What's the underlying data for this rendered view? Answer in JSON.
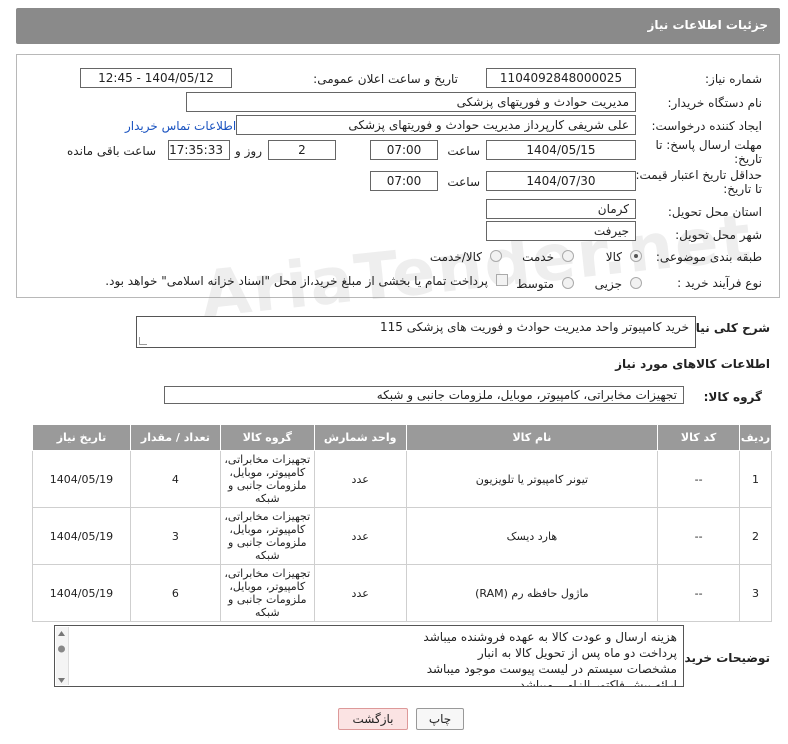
{
  "header": {
    "title": "جزئیات اطلاعات نیاز"
  },
  "form": {
    "need_number_label": "شماره نیاز:",
    "need_number": "1104092848000025",
    "announce_label": "تاریخ و ساعت اعلان عمومی:",
    "announce_value": "1404/05/12 - 12:45",
    "buyer_org_label": "نام دستگاه خریدار:",
    "buyer_org": "مدیریت حوادث و فوریتهای پزشکی",
    "creator_label": "ایجاد کننده درخواست:",
    "creator": "علی شریفی کارپرداز مدیریت حوادث و فوریتهای پزشکی",
    "contact_link": "اطلاعات تماس خریدار",
    "deadline_label_1": "مهلت ارسال پاسخ: تا",
    "deadline_label_2": "تاریخ:",
    "deadline_date": "1404/05/15",
    "time_label": "ساعت",
    "deadline_time": "07:00",
    "days_value": "2",
    "days_label": "روز و",
    "remaining_time": "17:35:33",
    "remaining_label": "ساعت باقی مانده",
    "price_validity_label_1": "حداقل تاریخ اعتبار قیمت:",
    "price_validity_label_2": "تا تاریخ:",
    "price_validity_date": "1404/07/30",
    "price_validity_time": "07:00",
    "province_label": "استان محل تحویل:",
    "province": "کرمان",
    "city_label": "شهر محل تحویل:",
    "city": "جیرفت",
    "category_label": "طبقه بندی موضوعی:",
    "category_options": [
      "کالا",
      "خدمت",
      "کالا/خدمت"
    ],
    "process_label": "نوع فرآیند خرید :",
    "process_options": [
      "جزیی",
      "متوسط"
    ],
    "process_note": "پرداخت تمام یا بخشی از مبلغ خرید،از محل \"اسناد خزانه اسلامی\" خواهد بود."
  },
  "description": {
    "label": "شرح کلی نیاز:",
    "text": "خرید کامپیوتر واحد مدیریت حوادث و فوریت های پزشکی 115"
  },
  "goods": {
    "section_title": "اطلاعات کالاهای مورد نیاز",
    "group_label": "گروه کالا:",
    "group_value": "تجهیزات مخابراتی، کامپیوتر، موبایل، ملزومات جانبی و شبکه",
    "columns": [
      "ردیف",
      "کد کالا",
      "نام کالا",
      "واحد شمارش",
      "گروه کالا",
      "تعداد / مقدار",
      "تاریخ نیاز"
    ],
    "rows": [
      {
        "row": "1",
        "code": "--",
        "name": "تیونر کامپیوتر یا تلویزیون",
        "unit": "عدد",
        "group": "تجهیزات مخابراتی، کامپیوتر، موبایل، ملزومات جانبی و شبکه",
        "qty": "4",
        "date": "1404/05/19"
      },
      {
        "row": "2",
        "code": "--",
        "name": "هارد دیسک",
        "unit": "عدد",
        "group": "تجهیزات مخابراتی، کامپیوتر، موبایل، ملزومات جانبی و شبکه",
        "qty": "3",
        "date": "1404/05/19"
      },
      {
        "row": "3",
        "code": "--",
        "name": "ماژول حافظه رم (RAM)",
        "unit": "عدد",
        "group": "تجهیزات مخابراتی، کامپیوتر، موبایل، ملزومات جانبی و شبکه",
        "qty": "6",
        "date": "1404/05/19"
      }
    ]
  },
  "notes": {
    "label": "توضیحات خریدار:",
    "lines": [
      "هزینه ارسال و عودت کالا به عهده فروشنده میباشد",
      "پرداخت دو ماه پس از تحویل کالا به انبار",
      "مشخصات سیستم در لیست پیوست موجود میباشد",
      "ارائه پیش فاکتور الزامی میباشد"
    ]
  },
  "buttons": {
    "print": "چاپ",
    "back": "بازگشت"
  },
  "watermark": "AriaTender.net",
  "colors": {
    "header_bg": "#8a8a8a",
    "table_header_bg": "#9a9a9a",
    "link": "#1a53c0",
    "back_button_bg": "#fbe3e3"
  }
}
